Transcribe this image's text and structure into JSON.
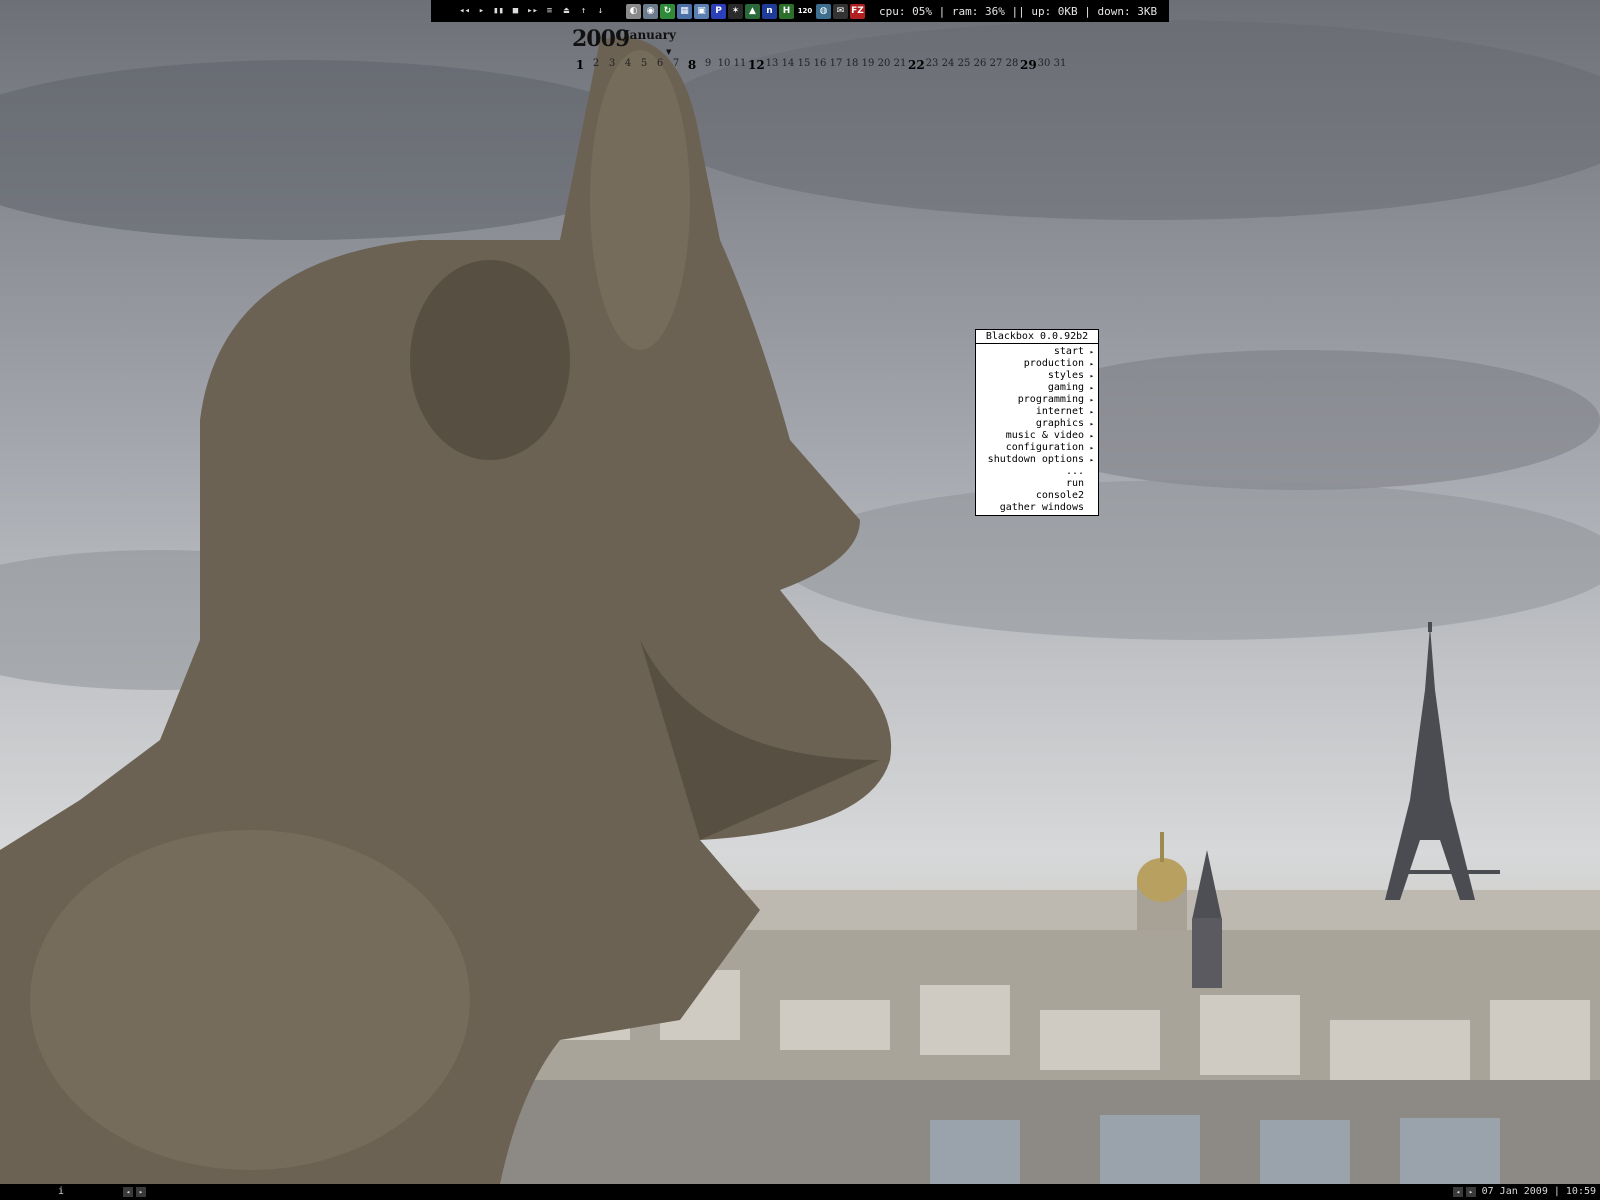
{
  "toolbar": {
    "media_buttons": [
      {
        "name": "prev-icon",
        "glyph": "◂◂"
      },
      {
        "name": "play-icon",
        "glyph": "▸"
      },
      {
        "name": "pause-icon",
        "glyph": "▮▮"
      },
      {
        "name": "stop-icon",
        "glyph": "■"
      },
      {
        "name": "next-icon",
        "glyph": "▸▸"
      },
      {
        "name": "playlist-icon",
        "glyph": "≡"
      },
      {
        "name": "eject-icon",
        "glyph": "⏏"
      },
      {
        "name": "volume-up-icon",
        "glyph": "↑"
      },
      {
        "name": "volume-down-icon",
        "glyph": "↓"
      }
    ],
    "tray_icons": [
      {
        "name": "tool-icon",
        "glyph": "◐",
        "color": "#8a8a8a"
      },
      {
        "name": "disc-icon",
        "glyph": "◉",
        "color": "#6b7b8c"
      },
      {
        "name": "refresh-icon",
        "glyph": "↻",
        "color": "#2f8a3a"
      },
      {
        "name": "network-icon",
        "glyph": "▦",
        "color": "#4c6fa8"
      },
      {
        "name": "monitor-icon",
        "glyph": "▣",
        "color": "#5a7fb0"
      },
      {
        "name": "p-app-icon",
        "glyph": "P",
        "color": "#2a3fb8"
      },
      {
        "name": "star-icon",
        "glyph": "✶",
        "color": "#2a2a2a"
      },
      {
        "name": "triangle-icon",
        "glyph": "▲",
        "color": "#2a6a3a"
      },
      {
        "name": "n-app-icon",
        "glyph": "n",
        "color": "#1e3c98"
      },
      {
        "name": "h-app-icon",
        "glyph": "H",
        "color": "#2c6f2c"
      },
      {
        "name": "120-icon",
        "glyph": "120",
        "color": "#000000"
      },
      {
        "name": "globe-icon",
        "glyph": "◍",
        "color": "#3b6e8f"
      },
      {
        "name": "mail-icon",
        "glyph": "✉",
        "color": "#333333"
      },
      {
        "name": "filezilla-icon",
        "glyph": "FZ",
        "color": "#b02020"
      }
    ],
    "status_text": "cpu: 05% | ram: 36% || up: 0KB | down: 3KB"
  },
  "calendar": {
    "year": "2009",
    "month": "January",
    "days": [
      "1",
      "2",
      "3",
      "4",
      "5",
      "6",
      "7",
      "8",
      "9",
      "10",
      "11",
      "12",
      "13",
      "14",
      "15",
      "16",
      "17",
      "18",
      "19",
      "20",
      "21",
      "22",
      "23",
      "24",
      "25",
      "26",
      "27",
      "28",
      "29",
      "30",
      "31"
    ],
    "highlighted_days": [
      "1",
      "8",
      "12",
      "22",
      "29"
    ]
  },
  "menu": {
    "title": "Blackbox 0.0.92b2",
    "items": [
      {
        "label": "start",
        "submenu": true
      },
      {
        "label": "production",
        "submenu": true
      },
      {
        "label": "styles",
        "submenu": true
      },
      {
        "label": "gaming",
        "submenu": true
      },
      {
        "label": "programming",
        "submenu": true
      },
      {
        "label": "internet",
        "submenu": true
      },
      {
        "label": "graphics",
        "submenu": true
      },
      {
        "label": "music & video",
        "submenu": true
      },
      {
        "label": "configuration",
        "submenu": true
      },
      {
        "label": "shutdown options",
        "submenu": true
      },
      {
        "label": "...",
        "submenu": false
      },
      {
        "label": "run",
        "submenu": false
      },
      {
        "label": "console2",
        "submenu": false
      },
      {
        "label": "gather windows",
        "submenu": false
      }
    ]
  },
  "bottombar": {
    "workspace_label": "i",
    "clock": "07 Jan 2009 | 10:59"
  }
}
